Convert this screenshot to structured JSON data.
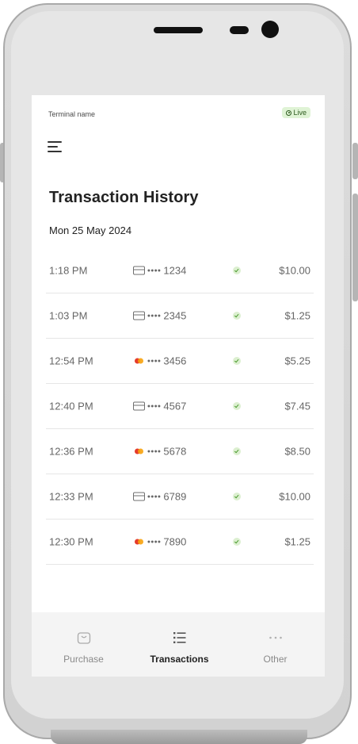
{
  "status": {
    "terminal_name": "Terminal name",
    "live_label": "Live"
  },
  "header": {
    "title": "Transaction History",
    "date": "Mon 25 May 2024"
  },
  "transactions": [
    {
      "time": "1:18 PM",
      "card_type": "card-icon",
      "last4": "1234",
      "status": "success",
      "amount": "$10.00"
    },
    {
      "time": "1:03 PM",
      "card_type": "card-icon",
      "last4": "2345",
      "status": "success",
      "amount": "$1.25"
    },
    {
      "time": "12:54 PM",
      "card_type": "mastercard-icon",
      "last4": "3456",
      "status": "success",
      "amount": "$5.25"
    },
    {
      "time": "12:40 PM",
      "card_type": "card-icon",
      "last4": "4567",
      "status": "success",
      "amount": "$7.45"
    },
    {
      "time": "12:36 PM",
      "card_type": "mastercard-icon",
      "last4": "5678",
      "status": "success",
      "amount": "$8.50"
    },
    {
      "time": "12:33 PM",
      "card_type": "card-icon",
      "last4": "6789",
      "status": "success",
      "amount": "$10.00"
    },
    {
      "time": "12:30 PM",
      "card_type": "mastercard-icon",
      "last4": "7890",
      "status": "success",
      "amount": "$1.25"
    }
  ],
  "masked_prefix": "••••",
  "tabs": [
    {
      "label": "Purchase",
      "icon": "bag-icon",
      "active": false
    },
    {
      "label": "Transactions",
      "icon": "list-icon",
      "active": true
    },
    {
      "label": "Other",
      "icon": "more-icon",
      "active": false
    }
  ],
  "colors": {
    "live_bg": "#dff3d5",
    "live_text": "#2d5a1e",
    "success": "#4a9b2e",
    "mc_red": "#e53b2b",
    "mc_yellow": "#f7a20c"
  }
}
